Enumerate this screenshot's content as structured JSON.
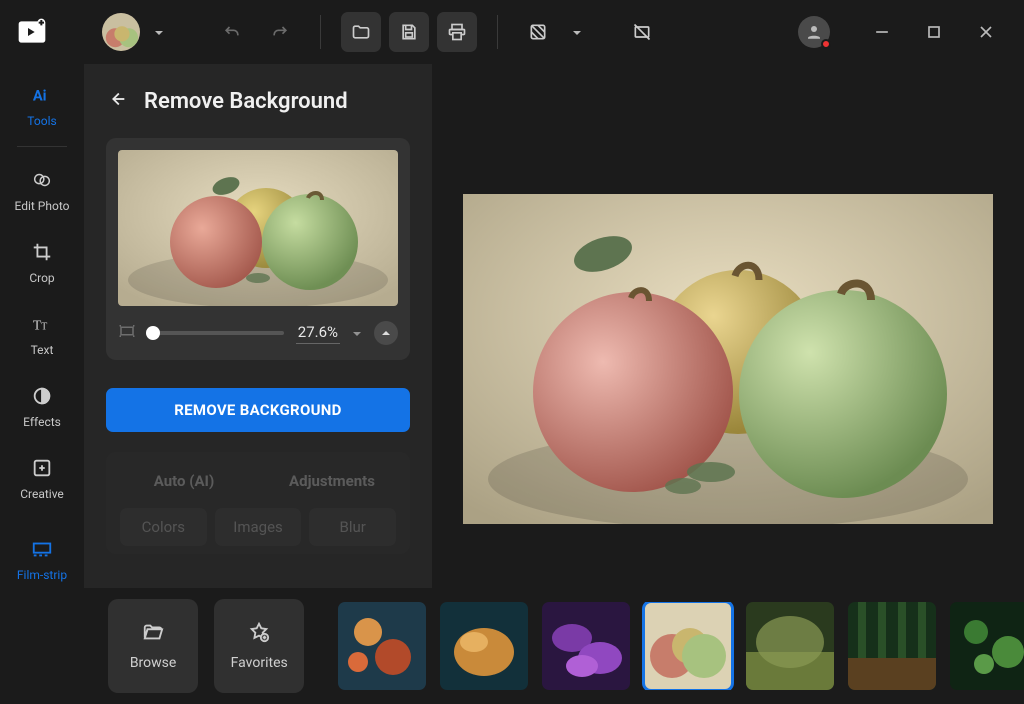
{
  "sidebar": {
    "items": [
      {
        "label": "Tools"
      },
      {
        "label": "Edit Photo"
      },
      {
        "label": "Crop"
      },
      {
        "label": "Text"
      },
      {
        "label": "Effects"
      },
      {
        "label": "Creative"
      }
    ],
    "bottom": {
      "label": "Film-strip"
    }
  },
  "panel": {
    "title": "Remove Background",
    "zoom_value": "27.6%",
    "action_label": "REMOVE BACKGROUND",
    "tabs": {
      "auto": "Auto (AI)",
      "adjustments": "Adjustments"
    },
    "subtabs": {
      "colors": "Colors",
      "images": "Images",
      "blur": "Blur"
    }
  },
  "strip": {
    "browse": "Browse",
    "favorites": "Favorites"
  }
}
